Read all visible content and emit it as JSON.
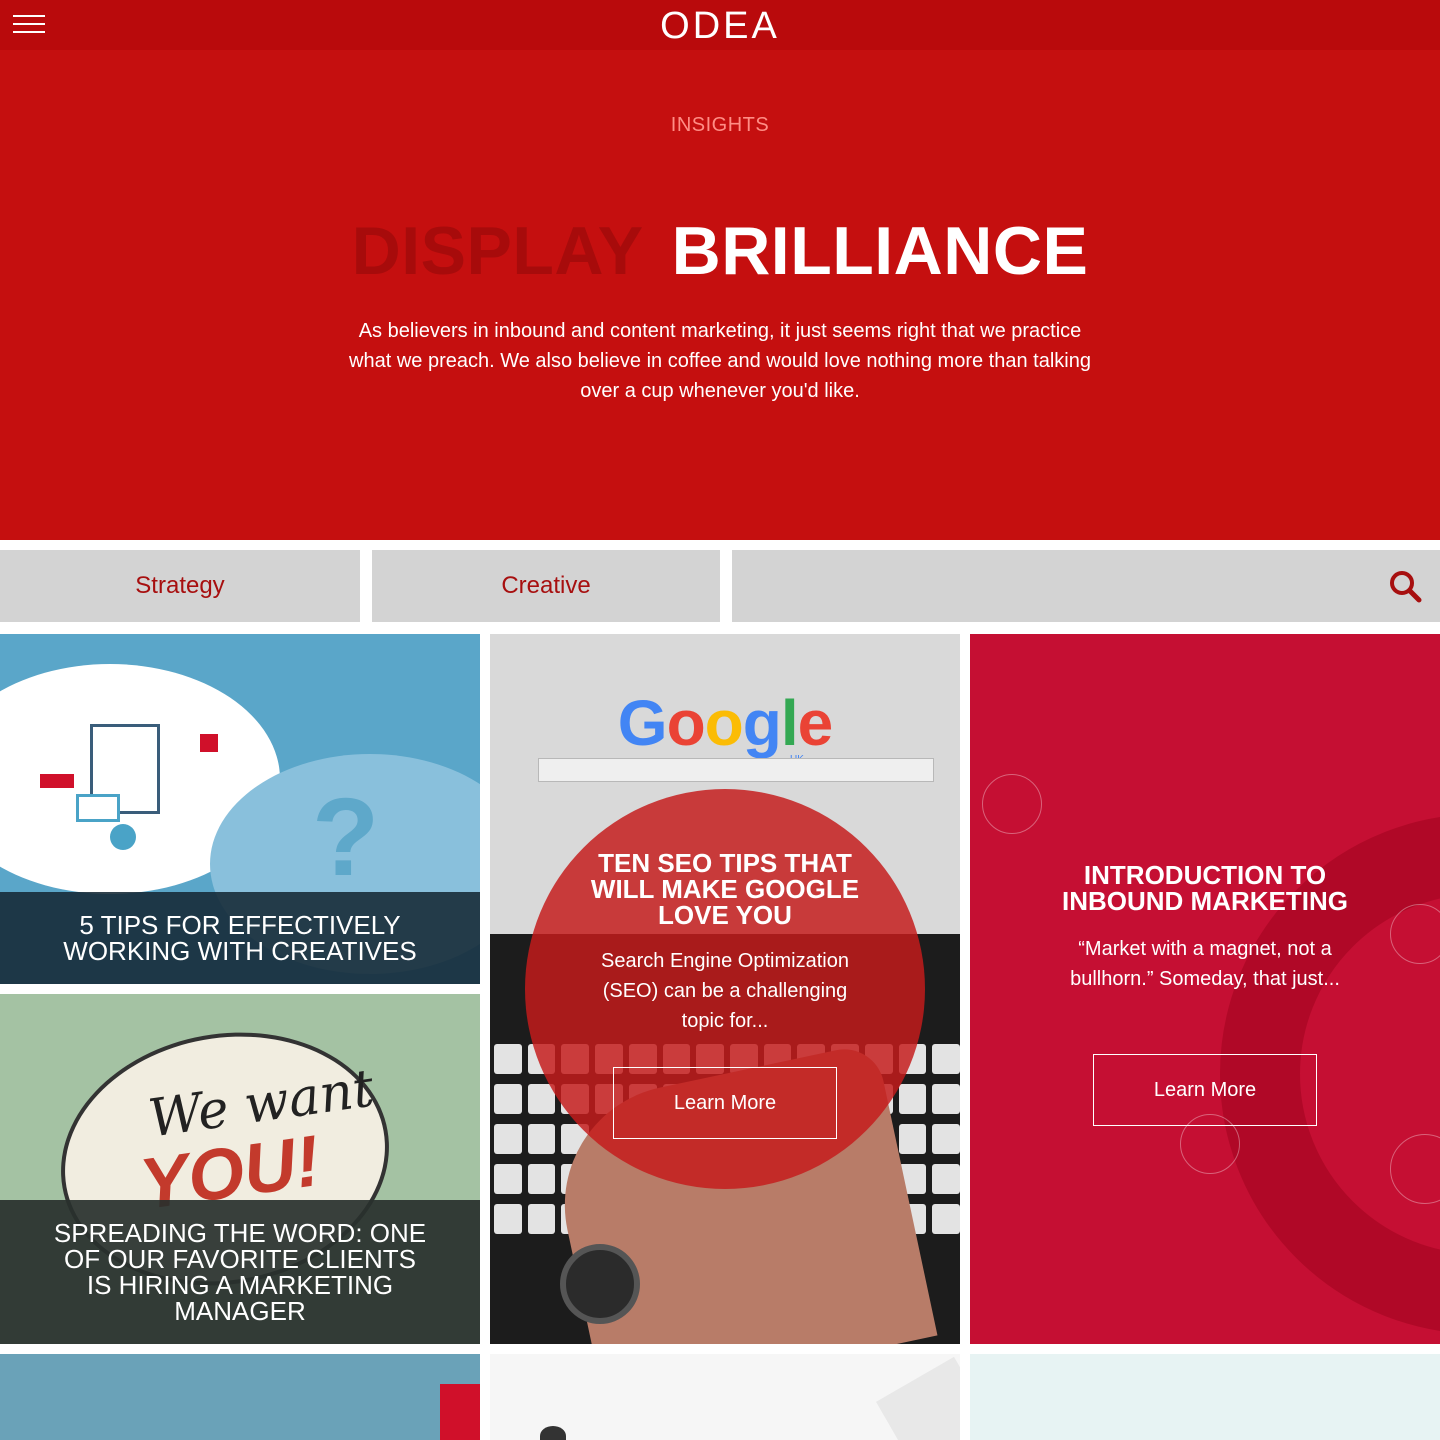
{
  "header": {
    "logo": "ODEA",
    "menu_icon": "hamburger-menu-icon"
  },
  "hero": {
    "eyebrow": "INSIGHTS",
    "headline_dim": "DISPLAY",
    "headline_bright": "BRILLIANCE",
    "intro": "As believers in inbound and content marketing, it just seems right that we practice what we preach. We also believe in coffee and would love nothing more than talking over a cup whenever you'd like."
  },
  "filters": {
    "strategy": "Strategy",
    "creative": "Creative",
    "search_icon": "search-icon"
  },
  "cards": [
    {
      "title": "5 TIPS FOR EFFECTIVELY WORKING WITH CREATIVES"
    },
    {
      "title": "TEN SEO TIPS THAT WILL MAKE GOOGLE LOVE YOU",
      "excerpt": "Search Engine Optimization (SEO) can be a challenging topic for...",
      "cta": "Learn More",
      "image_text": {
        "logo": "Google",
        "region": "UK"
      }
    },
    {
      "title": "INTRODUCTION TO INBOUND MARKETING",
      "excerpt": "“Market with a magnet, not a bullhorn.” Someday, that just...",
      "cta": "Learn More"
    },
    {
      "title": "SPREADING THE WORD: ONE OF OUR FAVORITE CLIENTS IS HIRING A MARKETING MANAGER",
      "image_text": {
        "line1": "We want",
        "line2": "YOU!"
      }
    }
  ],
  "colors": {
    "topbar": "#b90a0c",
    "hero": "#c50f0f",
    "filter_bg": "#d3d3d3",
    "filter_text": "#a70f0f",
    "inbound_card": "#c50f33"
  }
}
